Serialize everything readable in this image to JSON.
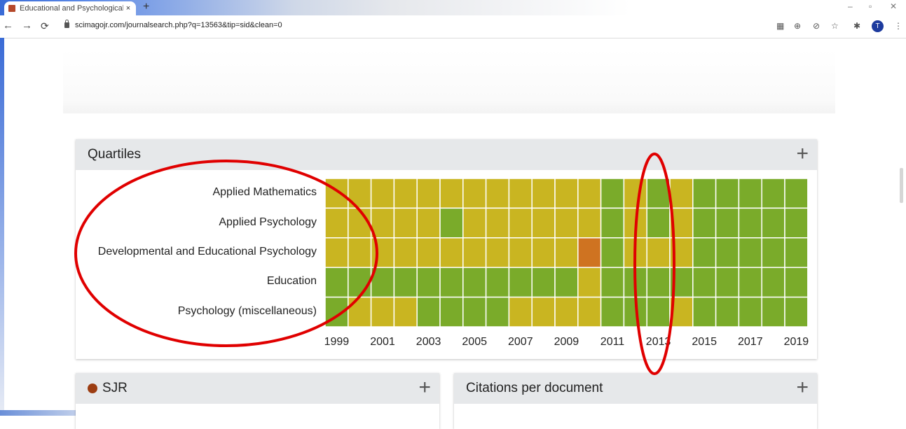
{
  "browser": {
    "tab_title": "Educational and Psychological M",
    "tab_close": "×",
    "new_tab": "+",
    "url": "scimagojr.com/journalsearch.php?q=13563&tip=sid&clean=0",
    "avatar_letter": "T"
  },
  "quartiles_panel": {
    "title": "Quartiles",
    "plus": "+"
  },
  "sjr_panel": {
    "title": "SJR",
    "plus": "+",
    "dot_color": "#9c3d12"
  },
  "citations_panel": {
    "title": "Citations per document",
    "plus": "+"
  },
  "chart_data": {
    "type": "heatmap",
    "categories": [
      "Applied Mathematics",
      "Applied Psychology",
      "Developmental and Educational Psychology",
      "Education",
      "Psychology (miscellaneous)"
    ],
    "years": [
      1999,
      2000,
      2001,
      2002,
      2003,
      2004,
      2005,
      2006,
      2007,
      2008,
      2009,
      2010,
      2011,
      2012,
      2013,
      2014,
      2015,
      2016,
      2017,
      2018,
      2019
    ],
    "x_tick_labels": [
      "1999",
      "2001",
      "2003",
      "2005",
      "2007",
      "2009",
      "2011",
      "2013",
      "2015",
      "2017",
      "2019"
    ],
    "quartile_colors": {
      "Q1": "#7aab2a",
      "Q2": "#c9b521",
      "Q3": "#cf7321"
    },
    "values": [
      [
        "Q2",
        "Q2",
        "Q2",
        "Q2",
        "Q2",
        "Q2",
        "Q2",
        "Q2",
        "Q2",
        "Q2",
        "Q2",
        "Q2",
        "Q1",
        "Q2",
        "Q1",
        "Q2",
        "Q1",
        "Q1",
        "Q1",
        "Q1",
        "Q1"
      ],
      [
        "Q2",
        "Q2",
        "Q2",
        "Q2",
        "Q2",
        "Q1",
        "Q2",
        "Q2",
        "Q2",
        "Q2",
        "Q2",
        "Q2",
        "Q1",
        "Q2",
        "Q1",
        "Q2",
        "Q1",
        "Q1",
        "Q1",
        "Q1",
        "Q1"
      ],
      [
        "Q2",
        "Q2",
        "Q2",
        "Q2",
        "Q2",
        "Q2",
        "Q2",
        "Q2",
        "Q2",
        "Q2",
        "Q2",
        "Q3",
        "Q1",
        "Q2",
        "Q2",
        "Q2",
        "Q1",
        "Q1",
        "Q1",
        "Q1",
        "Q1"
      ],
      [
        "Q1",
        "Q1",
        "Q1",
        "Q1",
        "Q1",
        "Q1",
        "Q1",
        "Q1",
        "Q1",
        "Q1",
        "Q1",
        "Q2",
        "Q1",
        "Q1",
        "Q1",
        "Q1",
        "Q1",
        "Q1",
        "Q1",
        "Q1",
        "Q1"
      ],
      [
        "Q1",
        "Q2",
        "Q2",
        "Q2",
        "Q1",
        "Q1",
        "Q1",
        "Q1",
        "Q2",
        "Q2",
        "Q2",
        "Q2",
        "Q1",
        "Q1",
        "Q1",
        "Q2",
        "Q1",
        "Q1",
        "Q1",
        "Q1",
        "Q1"
      ]
    ]
  }
}
